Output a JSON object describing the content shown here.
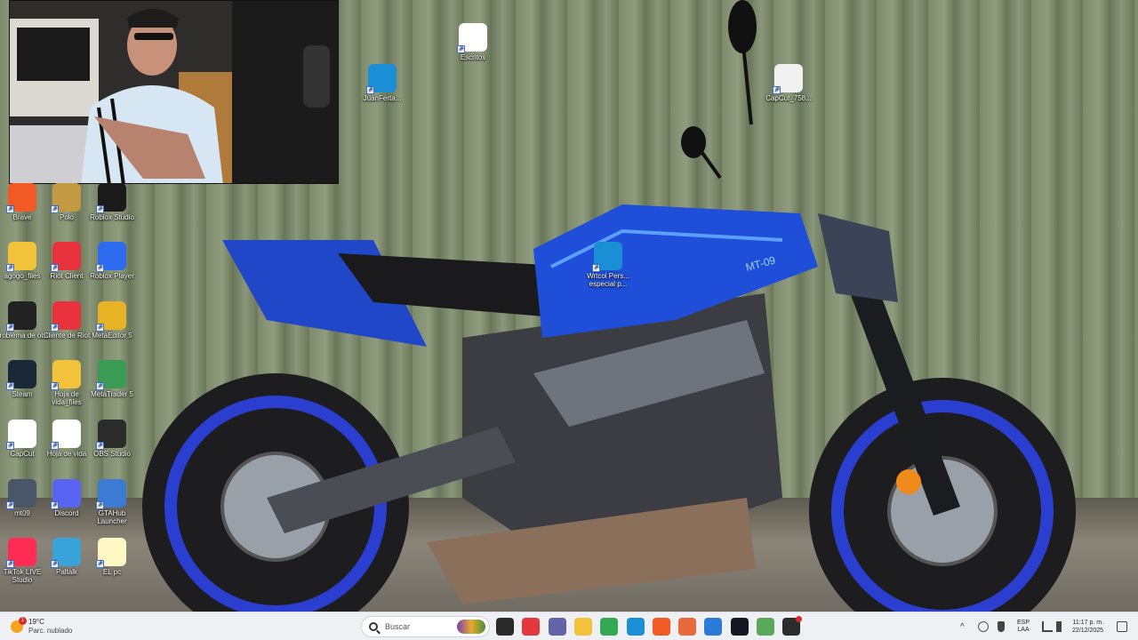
{
  "wallpaper": {
    "subject": "blue-naked-motorcycle",
    "tank_badge_text": "MT-09"
  },
  "webcam": {
    "label": "webcam-overlay"
  },
  "desktop_icons": [
    {
      "id": "escritos",
      "label": "Escritos",
      "icon": "document-icon",
      "color": "#ffffff"
    },
    {
      "id": "juanferta",
      "label": "JuanFerta...",
      "icon": "edge-icon",
      "color": "#1b8fd6"
    },
    {
      "id": "capcut758",
      "label": "CapCut_758...",
      "icon": "capcut-icon",
      "color": "#f0f0f0"
    },
    {
      "id": "wrtcol",
      "label": "Wrtcol Pers... especial p...",
      "icon": "edge-icon",
      "color": "#1b8fd6"
    },
    {
      "id": "brave",
      "label": "Brave",
      "icon": "brave-icon",
      "color": "#f15a24"
    },
    {
      "id": "polo",
      "label": "Polo",
      "icon": "league-icon",
      "color": "#c29a44"
    },
    {
      "id": "roblox-studio",
      "label": "Roblox Studio",
      "icon": "roblox-studio-icon",
      "color": "#1a1a1a"
    },
    {
      "id": "agogo",
      "label": "agogo_files",
      "icon": "folder-icon",
      "color": "#f2c23a"
    },
    {
      "id": "riot",
      "label": "Riot Client",
      "icon": "riot-icon",
      "color": "#e8323c"
    },
    {
      "id": "roblox-player",
      "label": "Roblox Player",
      "icon": "roblox-icon",
      "color": "#2d6cf0"
    },
    {
      "id": "problema-obs",
      "label": "problema de obs",
      "icon": "video-thumb-icon",
      "color": "#222222"
    },
    {
      "id": "cliente-riot",
      "label": "Cliente de Riot",
      "icon": "riot-icon",
      "color": "#e8323c"
    },
    {
      "id": "metaeditor",
      "label": "MetaEditor 5",
      "icon": "metaeditor-icon",
      "color": "#e5b323"
    },
    {
      "id": "steam",
      "label": "Steam",
      "icon": "steam-icon",
      "color": "#1b2838"
    },
    {
      "id": "hoja-vida-files",
      "label": "Hoja de vida_files",
      "icon": "folder-icon",
      "color": "#f2c23a"
    },
    {
      "id": "metatrader",
      "label": "MetaTrader 5",
      "icon": "metatrader-icon",
      "color": "#3a9b55"
    },
    {
      "id": "capcut",
      "label": "CapCut",
      "icon": "capcut-icon",
      "color": "#ffffff"
    },
    {
      "id": "hoja-vida",
      "label": "Hoja de vida",
      "icon": "chrome-doc-icon",
      "color": "#ffffff"
    },
    {
      "id": "obs",
      "label": "OBS Studio",
      "icon": "obs-icon",
      "color": "#2b2b2b"
    },
    {
      "id": "mt09",
      "label": "mt09",
      "icon": "image-thumb-icon",
      "color": "#4a5568"
    },
    {
      "id": "discord",
      "label": "Discord",
      "icon": "discord-icon",
      "color": "#5865f2"
    },
    {
      "id": "gtahub",
      "label": "GTAHub Launcher",
      "icon": "gtahub-icon",
      "color": "#3b7bd4"
    },
    {
      "id": "tiktok",
      "label": "TikTok LIVE Studio",
      "icon": "tiktok-icon",
      "color": "#fe2c55"
    },
    {
      "id": "paltalk",
      "label": "Paltalk",
      "icon": "paltalk-icon",
      "color": "#38a3d9"
    },
    {
      "id": "el-pc",
      "label": "EL pc",
      "icon": "text-file-icon",
      "color": "#fff8c4"
    }
  ],
  "taskbar": {
    "weather": {
      "temp": "19°C",
      "condition": "Parc. nublado",
      "badge": "1"
    },
    "search_placeholder": "Buscar",
    "pinned_apps": [
      {
        "id": "task-view",
        "icon": "task-view-icon",
        "color": "#2a2a2a"
      },
      {
        "id": "anydesk",
        "icon": "anydesk-icon",
        "color": "#e4393c"
      },
      {
        "id": "teams",
        "icon": "teams-icon",
        "color": "#6264a7"
      },
      {
        "id": "file-explorer",
        "icon": "folder-icon",
        "color": "#f2c23a"
      },
      {
        "id": "chrome",
        "icon": "chrome-icon",
        "color": "#34a853"
      },
      {
        "id": "edge",
        "icon": "edge-icon",
        "color": "#1b8fd6"
      },
      {
        "id": "brave",
        "icon": "brave-icon",
        "color": "#f15a24"
      },
      {
        "id": "mail",
        "icon": "mail-icon",
        "color": "#e86a3a"
      },
      {
        "id": "store",
        "icon": "store-icon",
        "color": "#2b7bd8"
      },
      {
        "id": "tradingview",
        "icon": "tradingview-icon",
        "color": "#131722"
      },
      {
        "id": "recycle",
        "icon": "recycle-icon",
        "color": "#5aa85a"
      },
      {
        "id": "obs",
        "icon": "obs-icon",
        "color": "#2b2b2b"
      }
    ],
    "language": {
      "line1": "ESP",
      "line2": "LAA"
    },
    "clock": {
      "time": "11:17 p. m.",
      "date": "22/12/2025"
    }
  }
}
